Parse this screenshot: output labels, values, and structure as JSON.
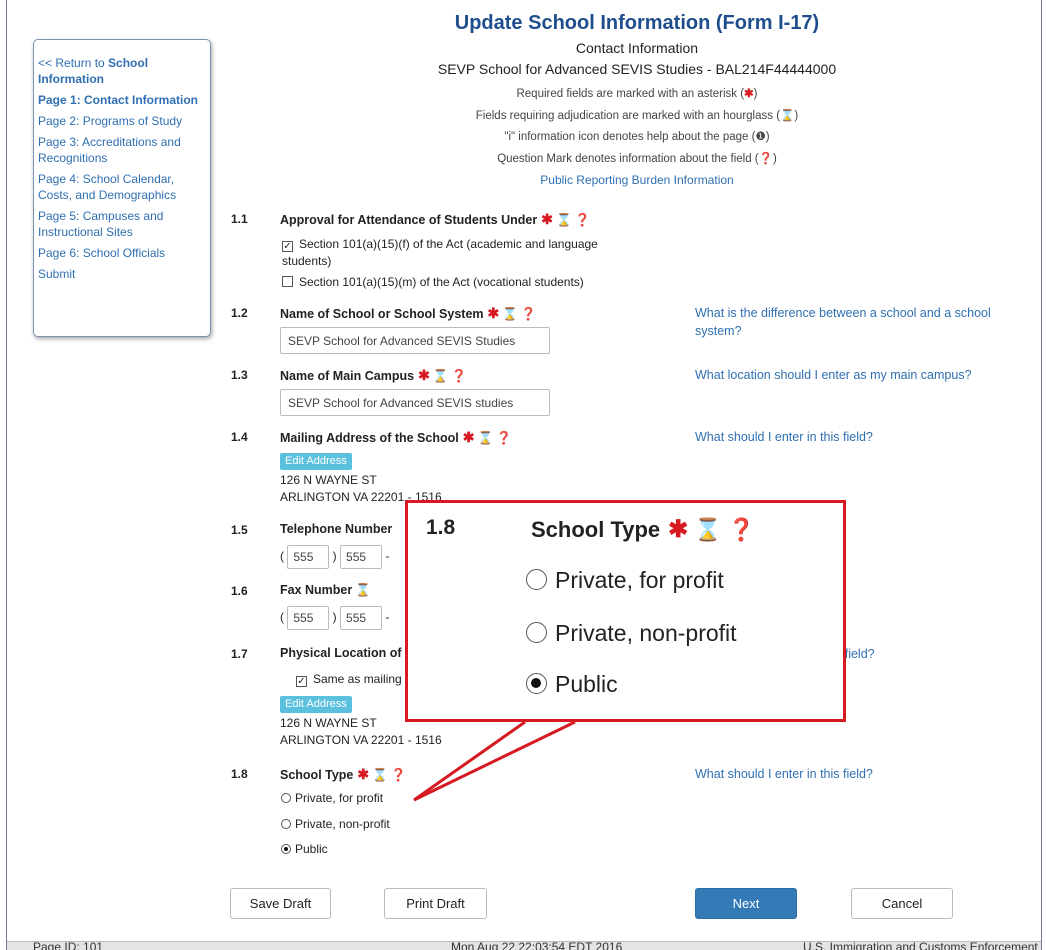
{
  "sidebar": {
    "return_prefix": "<< Return to ",
    "return_bold": "School Information",
    "items": [
      {
        "label": "Page 1: Contact Information"
      },
      {
        "label": "Page 2: Programs of Study"
      },
      {
        "label": "Page 3: Accreditations and Recognitions"
      },
      {
        "label": "Page 4: School Calendar, Costs, and Demographics"
      },
      {
        "label": "Page 5: Campuses and Instructional Sites"
      },
      {
        "label": "Page 6: School Officials"
      },
      {
        "label": "Submit"
      }
    ]
  },
  "header": {
    "title": "Update School Information (Form I-17)",
    "subtitle": "Contact Information",
    "school": "SEVP School for Advanced SEVIS Studies - BAL214F44444000",
    "legend_required": "Required fields are marked with an asterisk (",
    "legend_hourglass": "Fields requiring adjudication are marked with an hourglass (",
    "legend_info": "\"i\" information icon denotes help about the page (",
    "legend_question": "Question Mark denotes information about the field (",
    "close_paren": ")",
    "burden_link": "Public Reporting Burden Information"
  },
  "icons": {
    "asterisk": "✱",
    "hourglass": "⌛",
    "info": "❶",
    "question": "❓"
  },
  "form": {
    "f11": {
      "num": "1.1",
      "label": "Approval for Attendance of Students Under",
      "opt1": "Section 101(a)(15)(f) of the Act (academic and language",
      "opt1b": "students)",
      "opt2": "Section 101(a)(15)(m) of the Act (vocational students)"
    },
    "f12": {
      "num": "1.2",
      "label": "Name of School or School System",
      "value": "SEVP School for Advanced SEVIS Studies",
      "help1": "What is the difference between a school and a school",
      "help2": "system?"
    },
    "f13": {
      "num": "1.3",
      "label": "Name of Main Campus",
      "value": "SEVP School for Advanced SEVIS studies",
      "help": "What location should I enter as my main campus?"
    },
    "f14": {
      "num": "1.4",
      "label": "Mailing Address of the School",
      "edit": "Edit Address",
      "line1": "126 N WAYNE ST",
      "line2": "ARLINGTON VA 22201 - 1516",
      "help": "What should I enter in this field?"
    },
    "f15": {
      "num": "1.5",
      "label": "Telephone Number",
      "area": "555",
      "prefix": "555"
    },
    "f16": {
      "num": "1.6",
      "label": "Fax Number",
      "area": "555",
      "prefix": "555"
    },
    "f17": {
      "num": "1.7",
      "label": "Physical Location of",
      "same": "Same as mailing",
      "edit": "Edit Address",
      "line1": "126 N WAYNE ST",
      "line2": "ARLINGTON VA 22201 - 1516",
      "help_tail": "s field?"
    },
    "f18": {
      "num": "1.8",
      "label": "School Type",
      "opt1": "Private, for profit",
      "opt2": "Private, non-profit",
      "opt3": "Public",
      "help": "What should I enter in this field?"
    }
  },
  "buttons": {
    "save": "Save Draft",
    "print": "Print Draft",
    "next": "Next",
    "cancel": "Cancel"
  },
  "footer": {
    "page_id": "Page ID: 101",
    "timestamp": "Mon Aug 22 22:03:54 EDT 2016",
    "agency": "U.S. Immigration and Customs Enforcement"
  },
  "callout": {
    "num": "1.8",
    "label": "School Type",
    "opt1": "Private, for profit",
    "opt2": "Private, non-profit",
    "opt3": "Public"
  },
  "paren_open": "(",
  "dash": "-"
}
